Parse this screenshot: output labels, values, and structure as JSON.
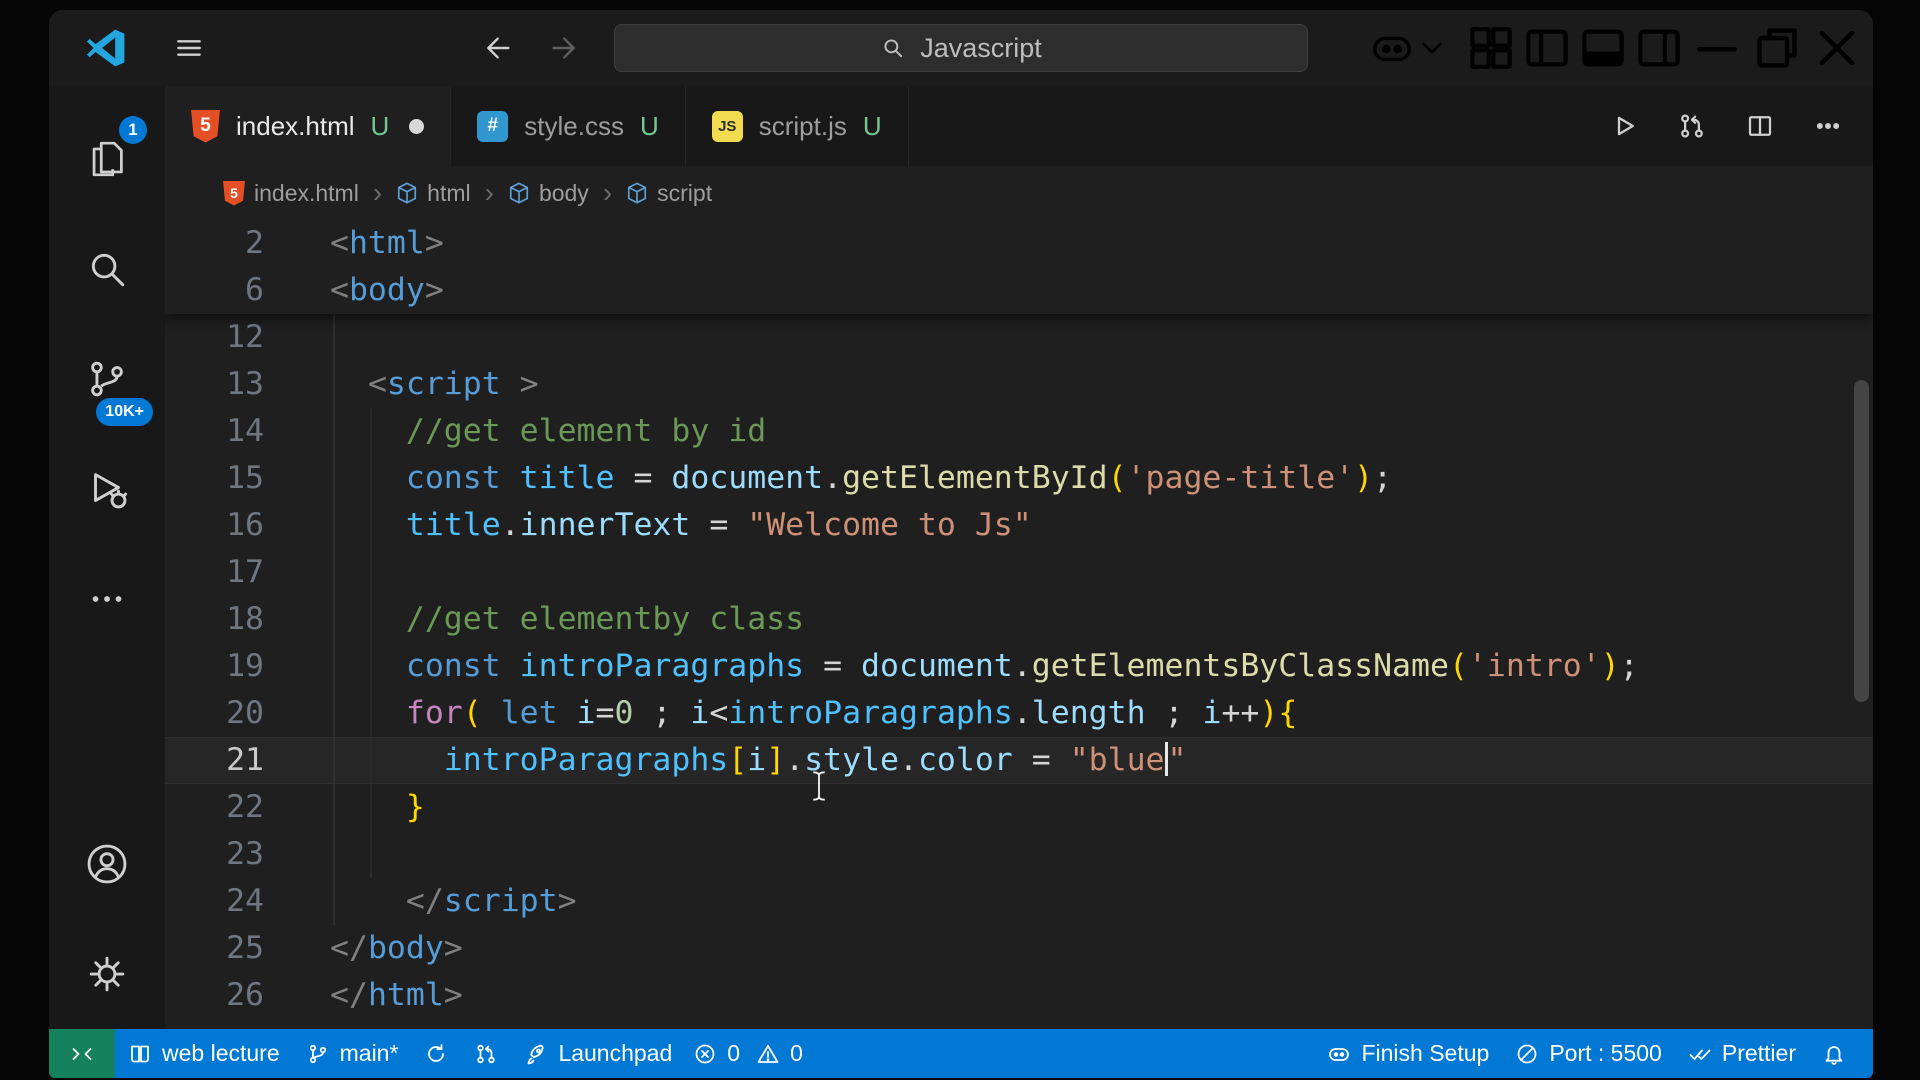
{
  "titlebar": {
    "search_text": "Javascript",
    "left_icons": [
      "vscode-logo",
      "menu",
      "arrow-left",
      "arrow-right"
    ],
    "right_icons": [
      "copilot",
      "chevron-down",
      "layout-grid",
      "layout-left",
      "layout-bottom",
      "layout-right",
      "minimize",
      "restore",
      "close"
    ]
  },
  "activity_bar": {
    "top": [
      {
        "icon": "files",
        "badge": "1",
        "badge_shape": "round"
      },
      {
        "icon": "search-big"
      },
      {
        "icon": "scm",
        "badge": "10K+",
        "badge_shape": "pill"
      },
      {
        "icon": "debug"
      },
      {
        "icon": "more"
      }
    ],
    "bottom": [
      {
        "icon": "account"
      },
      {
        "icon": "gear"
      }
    ]
  },
  "tabs": [
    {
      "label": "index.html",
      "git": "U",
      "icon": "html-file",
      "modified": true,
      "active": true
    },
    {
      "label": "style.css",
      "git": "U",
      "icon": "css-file",
      "modified": false,
      "active": false
    },
    {
      "label": "script.js",
      "git": "U",
      "icon": "js-file",
      "modified": false,
      "active": false
    }
  ],
  "editor_actions": [
    "run",
    "pr",
    "split",
    "ellipsis"
  ],
  "breadcrumb": [
    {
      "label": "index.html",
      "icon": "html-file"
    },
    {
      "label": "html",
      "icon": "symbol-box"
    },
    {
      "label": "body",
      "icon": "symbol-box"
    },
    {
      "label": "script",
      "icon": "symbol-box"
    }
  ],
  "editor": {
    "current_line": 21,
    "sticky": [
      {
        "num": 2,
        "tokens": [
          {
            "t": "<",
            "c": "punct"
          },
          {
            "t": "html",
            "c": "tag"
          },
          {
            "t": ">",
            "c": "punct"
          }
        ]
      },
      {
        "num": 6,
        "tokens": [
          {
            "t": "<",
            "c": "punct"
          },
          {
            "t": "body",
            "c": "tag"
          },
          {
            "t": ">",
            "c": "punct"
          }
        ]
      }
    ],
    "lines": [
      {
        "num": 12,
        "tokens": []
      },
      {
        "num": 13,
        "tokens": [
          {
            "t": "  "
          },
          {
            "t": "<",
            "c": "punct"
          },
          {
            "t": "script",
            "c": "tag"
          },
          {
            "t": " "
          },
          {
            "t": ">",
            "c": "punct"
          }
        ]
      },
      {
        "num": 14,
        "tokens": [
          {
            "t": "    "
          },
          {
            "t": "//get element by id",
            "c": "comment"
          }
        ]
      },
      {
        "num": 15,
        "tokens": [
          {
            "t": "    "
          },
          {
            "t": "const",
            "c": "kw"
          },
          {
            "t": " "
          },
          {
            "t": "title",
            "c": "cvar"
          },
          {
            "t": " "
          },
          {
            "t": "=",
            "c": "op"
          },
          {
            "t": " "
          },
          {
            "t": "document",
            "c": "var"
          },
          {
            "t": "."
          },
          {
            "t": "getElementById",
            "c": "fn"
          },
          {
            "t": "(",
            "c": "b1"
          },
          {
            "t": "'page-title'",
            "c": "str"
          },
          {
            "t": ")",
            "c": "b1"
          },
          {
            "t": ";"
          }
        ]
      },
      {
        "num": 16,
        "tokens": [
          {
            "t": "    "
          },
          {
            "t": "title",
            "c": "cvar"
          },
          {
            "t": "."
          },
          {
            "t": "innerText",
            "c": "var"
          },
          {
            "t": " "
          },
          {
            "t": "=",
            "c": "op"
          },
          {
            "t": " "
          },
          {
            "t": "\"Welcome to Js\"",
            "c": "str"
          }
        ]
      },
      {
        "num": 17,
        "tokens": []
      },
      {
        "num": 18,
        "tokens": [
          {
            "t": "    "
          },
          {
            "t": "//get elementby class",
            "c": "comment"
          }
        ]
      },
      {
        "num": 19,
        "tokens": [
          {
            "t": "    "
          },
          {
            "t": "const",
            "c": "kw"
          },
          {
            "t": " "
          },
          {
            "t": "introParagraphs",
            "c": "cvar"
          },
          {
            "t": " "
          },
          {
            "t": "=",
            "c": "op"
          },
          {
            "t": " "
          },
          {
            "t": "document",
            "c": "var"
          },
          {
            "t": "."
          },
          {
            "t": "getElementsByClassName",
            "c": "fn"
          },
          {
            "t": "(",
            "c": "b1"
          },
          {
            "t": "'intro'",
            "c": "str"
          },
          {
            "t": ")",
            "c": "b1"
          },
          {
            "t": ";"
          }
        ]
      },
      {
        "num": 20,
        "tokens": [
          {
            "t": "    "
          },
          {
            "t": "for",
            "c": "ctrl"
          },
          {
            "t": "(",
            "c": "b1"
          },
          {
            "t": " "
          },
          {
            "t": "let",
            "c": "kw"
          },
          {
            "t": " "
          },
          {
            "t": "i",
            "c": "var"
          },
          {
            "t": "=",
            "c": "op"
          },
          {
            "t": "0",
            "c": "num"
          },
          {
            "t": " ; "
          },
          {
            "t": "i",
            "c": "var"
          },
          {
            "t": "<",
            "c": "op"
          },
          {
            "t": "introParagraphs",
            "c": "cvar"
          },
          {
            "t": "."
          },
          {
            "t": "length",
            "c": "var"
          },
          {
            "t": " ; "
          },
          {
            "t": "i",
            "c": "var"
          },
          {
            "t": "++",
            "c": "op"
          },
          {
            "t": ")",
            "c": "b1"
          },
          {
            "t": "{",
            "c": "b1"
          }
        ]
      },
      {
        "num": 21,
        "tokens": [
          {
            "t": "      "
          },
          {
            "t": "introParagraphs",
            "c": "cvar"
          },
          {
            "t": "[",
            "c": "b1"
          },
          {
            "t": "i",
            "c": "var"
          },
          {
            "t": "]",
            "c": "b1"
          },
          {
            "t": "."
          },
          {
            "t": "style",
            "c": "var"
          },
          {
            "t": "."
          },
          {
            "t": "color",
            "c": "var"
          },
          {
            "t": " "
          },
          {
            "t": "=",
            "c": "op"
          },
          {
            "t": " "
          },
          {
            "t": "\"blue",
            "c": "str"
          },
          {
            "caret": true
          },
          {
            "t": "\"",
            "c": "str"
          }
        ]
      },
      {
        "num": 22,
        "tokens": [
          {
            "t": "    "
          },
          {
            "t": "}",
            "c": "b1"
          }
        ]
      },
      {
        "num": 23,
        "tokens": []
      },
      {
        "num": 24,
        "tokens": [
          {
            "t": "    "
          },
          {
            "t": "</",
            "c": "punct"
          },
          {
            "t": "script",
            "c": "tag"
          },
          {
            "t": ">",
            "c": "punct"
          }
        ]
      },
      {
        "num": 25,
        "tokens": [
          {
            "t": "</",
            "c": "punct"
          },
          {
            "t": "body",
            "c": "tag"
          },
          {
            "t": ">",
            "c": "punct"
          }
        ]
      },
      {
        "num": 26,
        "tokens": [
          {
            "t": "</",
            "c": "punct"
          },
          {
            "t": "html",
            "c": "tag"
          },
          {
            "t": ">",
            "c": "punct"
          }
        ]
      }
    ]
  },
  "status_bar": {
    "left": [
      {
        "icon": "remote",
        "label": "",
        "chip": true
      },
      {
        "icon": "book",
        "label": "web lecture"
      },
      {
        "icon": "branch",
        "label": "main*"
      },
      {
        "icon": "sync",
        "label": ""
      },
      {
        "icon": "pr",
        "label": ""
      },
      {
        "icon": "rocket",
        "label": "Launchpad"
      },
      {
        "icon": "error",
        "label": "0",
        "tight": true
      },
      {
        "icon": "warning",
        "label": "0",
        "tight": true
      }
    ],
    "right": [
      {
        "icon": "copilot",
        "label": "Finish Setup"
      },
      {
        "icon": "slash",
        "label": "Port : 5500"
      },
      {
        "icon": "checkcheck",
        "label": "Prettier"
      },
      {
        "icon": "bell",
        "label": ""
      }
    ]
  },
  "colors": {
    "status_bar": "#0078d4",
    "remote_chip": "#16825d",
    "badge": "#0078d4",
    "git_untracked": "#73c991",
    "html_icon": "#e44f26",
    "css_icon": "#3397cf",
    "js_icon": "#f0dc4e",
    "logo": "#24a7e0",
    "editor_bg": "#1f1f1f",
    "chrome_bg": "#181818"
  },
  "syntax_colors": {
    "tag": "#569cd6",
    "punctuation": "#808080",
    "comment": "#6a9955",
    "keyword": "#569cd6",
    "control": "#c586c0",
    "variable": "#9cdcfe",
    "const_variable": "#4fc1ff",
    "function": "#dcdcaa",
    "string": "#ce9178",
    "number": "#b5cea8",
    "operator": "#d4d4d4",
    "bracket": "#ffd700"
  }
}
